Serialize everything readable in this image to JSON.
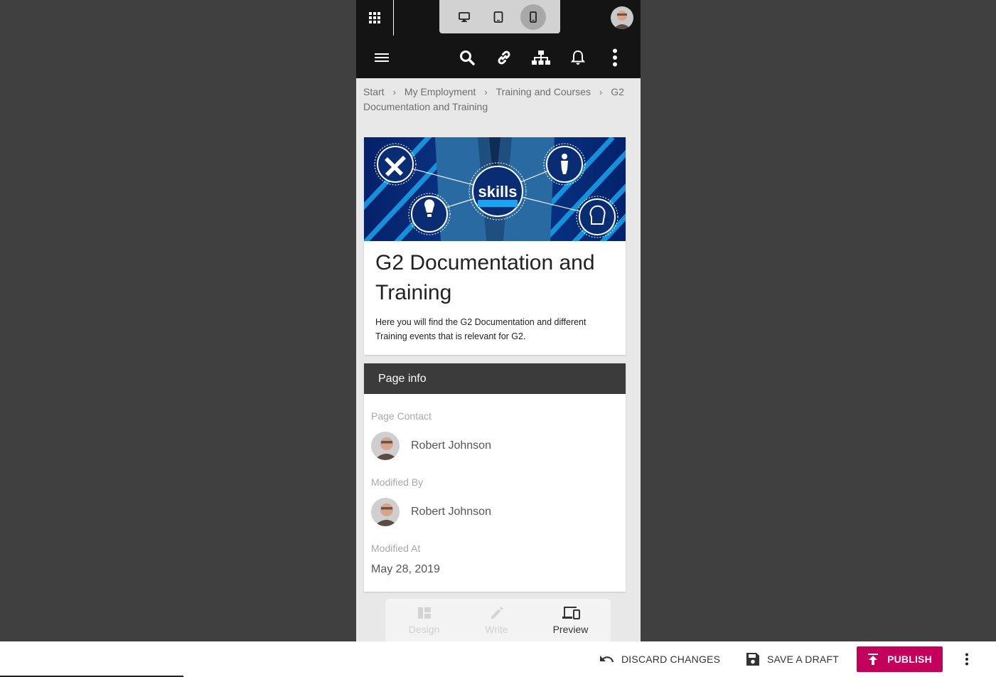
{
  "device_switcher": {
    "options": [
      "desktop-icon",
      "tablet-icon",
      "phone-icon"
    ],
    "active": "phone"
  },
  "topbar": {
    "apps_icon": "apps-grid-icon"
  },
  "navbar": {
    "icons": [
      "menu-icon",
      "search-icon",
      "link-icon",
      "sitemap-icon",
      "bell-icon",
      "more-vertical-icon"
    ]
  },
  "breadcrumb": {
    "items": [
      "Start",
      "My Employment",
      "Training and Courses",
      "G2 Documentation and Training"
    ]
  },
  "hero": {
    "image_text": "skills",
    "title": "G2 Documentation and Training",
    "description": "Here you will find the G2 Documentation and different Training events that is relevant for G2."
  },
  "page_info": {
    "header": "Page info",
    "contact_label": "Page Contact",
    "contact_name": "Robert Johnson",
    "modified_by_label": "Modified By",
    "modified_by_name": "Robert Johnson",
    "modified_at_label": "Modified At",
    "modified_at": "May 28, 2019"
  },
  "mode_tabs": {
    "design": "Design",
    "write": "Write",
    "preview": "Preview",
    "active": "preview"
  },
  "footer": {
    "discard": "DISCARD CHANGES",
    "save_draft": "SAVE A DRAFT",
    "publish": "PUBLISH"
  },
  "colors": {
    "publish": "#c4005d",
    "bars": "#141414",
    "info_header": "#3b3b3b"
  }
}
